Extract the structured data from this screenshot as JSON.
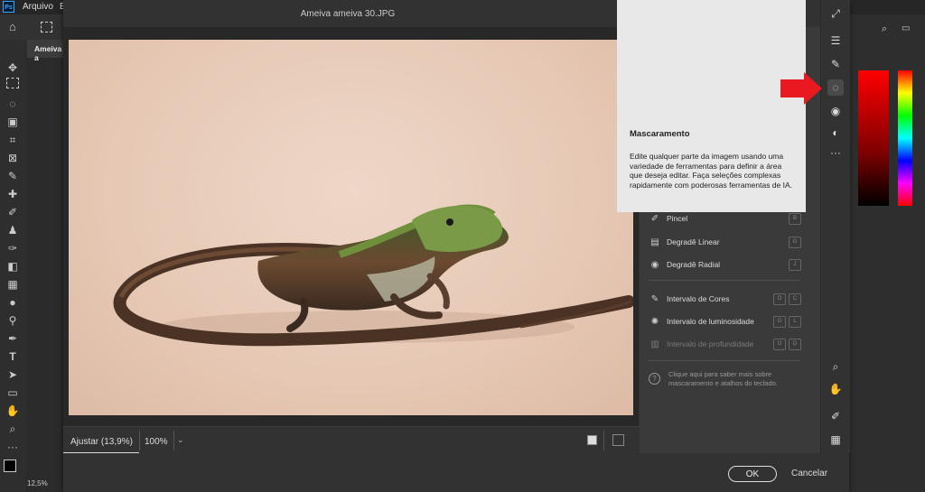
{
  "app": {
    "logo": "Ps",
    "menu": [
      "Arquivo",
      "E"
    ],
    "doc_tab": "Ameiva a",
    "status_zoom": "12,5%"
  },
  "dialog": {
    "title": "Ameiva ameiva 30.JPG",
    "fit_label": "Ajustar (13,9%)",
    "zoom_label": "100%",
    "ok": "OK",
    "cancel": "Cancelar"
  },
  "tooltip": {
    "title": "Mascaramento",
    "body": "Edite qualquer parte da imagem usando uma variedade de ferramentas para definir a área que deseja editar. Faça seleções complexas rapidamente com poderosas ferramentas de IA."
  },
  "mask_panel": {
    "items": [
      {
        "label": "Pincel",
        "icon": "brush-icon",
        "keys": [
          "B"
        ],
        "enabled": true
      },
      {
        "label": "Degradê Linear",
        "icon": "linear-gradient-icon",
        "keys": [
          "G"
        ],
        "enabled": true
      },
      {
        "label": "Degradê Radial",
        "icon": "radial-gradient-icon",
        "keys": [
          "J"
        ],
        "enabled": true
      },
      {
        "label": "Intervalo de Cores",
        "icon": "color-range-icon",
        "keys": [
          "O",
          "C"
        ],
        "enabled": true
      },
      {
        "label": "Intervalo de luminosidade",
        "icon": "luminance-range-icon",
        "keys": [
          "O",
          "L"
        ],
        "enabled": true
      },
      {
        "label": "Intervalo de profundidade",
        "icon": "depth-range-icon",
        "keys": [
          "O",
          "D"
        ],
        "enabled": false
      }
    ],
    "help": "Clique aqui para saber mais sobre mascaramento e atalhos do teclado."
  },
  "colors": {
    "accent_arrow": "#e8191f",
    "tooltip_bg": "#e8e8e8",
    "panel_bg": "#3a3a3a"
  }
}
